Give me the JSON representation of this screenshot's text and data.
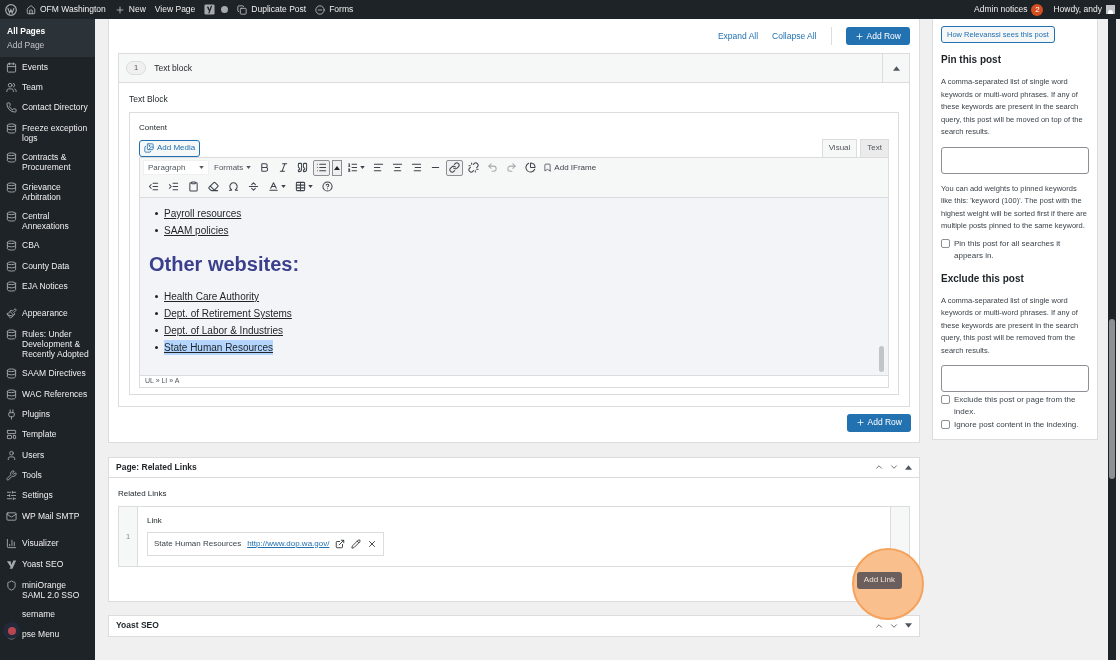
{
  "admin_bar": {
    "site": "OFM Washington",
    "items": [
      {
        "kind": "new",
        "label": "New"
      },
      {
        "kind": "plain",
        "label": "View Page"
      },
      {
        "kind": "yoast"
      },
      {
        "kind": "dot"
      },
      {
        "kind": "duplicate",
        "label": "Duplicate Post"
      },
      {
        "kind": "forms",
        "label": "Forms"
      }
    ],
    "notices": {
      "label": "Admin notices",
      "count": "2"
    },
    "greeting": "Howdy, andy"
  },
  "sidebar": {
    "submenu": [
      {
        "label": "All Pages",
        "selected": true
      },
      {
        "label": "Add Page",
        "selected": false
      }
    ],
    "groups": [
      [
        {
          "kind": "calendar",
          "label": "Events"
        },
        {
          "kind": "team",
          "label": "Team"
        },
        {
          "kind": "phone",
          "label": "Contact Directory"
        },
        {
          "kind": "database",
          "label": "Freeze exception logs"
        },
        {
          "kind": "database",
          "label": "Contracts & Procurement"
        },
        {
          "kind": "database",
          "label": "Grievance Arbitration"
        },
        {
          "kind": "database",
          "label": "Central Annexations"
        },
        {
          "kind": "database",
          "label": "CBA"
        },
        {
          "kind": "database",
          "label": "County Data"
        },
        {
          "kind": "database",
          "label": "EJA Notices"
        }
      ],
      [
        {
          "kind": "brush",
          "label": "Appearance"
        },
        {
          "kind": "database",
          "label": "Rules: Under Development & Recently Adopted"
        },
        {
          "kind": "database",
          "label": "SAAM Directives"
        },
        {
          "kind": "database",
          "label": "WAC References"
        },
        {
          "kind": "plug",
          "label": "Plugins"
        },
        {
          "kind": "template",
          "label": "Template"
        },
        {
          "kind": "user",
          "label": "Users"
        },
        {
          "kind": "wrench",
          "label": "Tools"
        },
        {
          "kind": "sliders",
          "label": "Settings"
        },
        {
          "kind": "mail",
          "label": "WP Mail SMTP"
        }
      ],
      [
        {
          "kind": "chart",
          "label": "Visualizer"
        },
        {
          "kind": "yoast",
          "label": "Yoast SEO"
        },
        {
          "kind": "shield",
          "label": "miniOrange SAML 2.0 SSO"
        },
        {
          "kind": "obscured",
          "label": "sername"
        },
        {
          "kind": "collapse",
          "label": "pse Menu"
        }
      ]
    ]
  },
  "flexible_content": {
    "actions": [
      "Expand All",
      "Collapse All"
    ],
    "add_row": "Add Row",
    "block": {
      "number": "1",
      "title": "Text block",
      "expanded": true,
      "field_label": "Text Block",
      "editor": {
        "label": "Content",
        "add_media": "Add Media",
        "tabs": [
          {
            "label": "Visual",
            "selected": true
          },
          {
            "label": "Text",
            "selected": false
          }
        ],
        "format": "Paragraph",
        "formats": "Formats",
        "add_iframe": "Add IFrame",
        "row1": [
          {
            "kind": "bold",
            "active": false
          },
          {
            "kind": "italic",
            "active": false
          },
          {
            "kind": "quote",
            "active": false
          },
          {
            "kind": "bullets",
            "active": true
          },
          {
            "kind": "split-caret",
            "active": true
          },
          {
            "kind": "numbered",
            "active": false,
            "menu": true
          },
          {
            "kind": "align-left",
            "active": false
          },
          {
            "kind": "align-center",
            "active": false
          },
          {
            "kind": "align-right",
            "active": false
          },
          {
            "kind": "rule",
            "active": false
          },
          {
            "kind": "link",
            "active": true
          },
          {
            "kind": "unlink",
            "active": false
          },
          {
            "kind": "undo",
            "active": false
          },
          {
            "kind": "redo",
            "active": false
          },
          {
            "kind": "pie",
            "active": false
          }
        ],
        "row2": [
          {
            "kind": "outdent",
            "active": false
          },
          {
            "kind": "indent",
            "active": false
          },
          {
            "kind": "paste",
            "active": false
          },
          {
            "kind": "eraser",
            "active": false
          },
          {
            "kind": "omega",
            "active": false
          },
          {
            "kind": "more",
            "active": false
          },
          {
            "kind": "text-color",
            "active": false,
            "menu": true
          },
          {
            "kind": "table",
            "active": false,
            "menu": true
          },
          {
            "kind": "help",
            "active": false
          }
        ],
        "list_top": [
          {
            "text": "Payroll resources",
            "selected": false
          },
          {
            "text": "SAAM policies",
            "selected": false
          }
        ],
        "heading": "Other websites:",
        "list_bottom": [
          {
            "text": "Health Care Authority",
            "selected": false
          },
          {
            "text": "Dept. of Retirement Systems",
            "selected": false
          },
          {
            "text": "Dept. of Labor & Industries",
            "selected": false
          },
          {
            "text": "State Human Resources",
            "selected": true
          }
        ],
        "path": "UL » LI » A"
      }
    },
    "add_row_bottom": "Add Row"
  },
  "related_links": {
    "title": "Page: Related Links",
    "expanded": true,
    "field_label": "Related Links",
    "row_number": "1",
    "column": "Link",
    "link_title": "State Human Resources",
    "url": "http://www.dop.wa.gov/",
    "add_link": "Add Link",
    "highlighted": true
  },
  "yoast": {
    "title": "Yoast SEO",
    "expanded": false
  },
  "relevanssi": {
    "button": "How Relevanssi sees this post",
    "pin": {
      "heading": "Pin this post",
      "description": "A comma-separated list of single word keywords or multi-word phrases. If any of these keywords are present in the search query, this post will be moved on top of the search results.",
      "note": "You can add weights to pinned keywords like this: 'keyword (100)'. The post with the highest weight will be sorted first if there are multiple posts pinned to the same keyword.",
      "checkboxes": [
        {
          "label": "Pin this post for all searches it appears in.",
          "checked": false
        }
      ]
    },
    "exclude": {
      "heading": "Exclude this post",
      "description": "A comma-separated list of single word keywords or multi-word phrases. If any of these keywords are present in the search query, this post will be removed from the search results.",
      "checkboxes": [
        {
          "label": "Exclude this post or page from the index.",
          "checked": false
        },
        {
          "label": "Ignore post content in the indexing.",
          "checked": false
        }
      ]
    }
  }
}
